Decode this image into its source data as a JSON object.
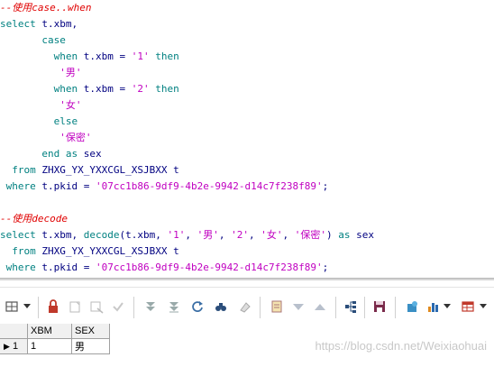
{
  "editor": {
    "line1": "--使用case..when",
    "line2_kw": "select",
    "line2_rest": "t.xbm,",
    "line3_kw": "case",
    "line4_kw1": "when",
    "line4_mid": "t.xbm =",
    "line4_str": "'1'",
    "line4_kw2": "then",
    "line5_str": "'男'",
    "line6_kw1": "when",
    "line6_mid": "t.xbm =",
    "line6_str": "'2'",
    "line6_kw2": "then",
    "line7_str": "'女'",
    "line8_kw": "else",
    "line9_str": "'保密'",
    "line10_kw1": "end",
    "line10_kw2": "as",
    "line10_id": "sex",
    "line11_kw": "from",
    "line11_id": "ZHXG_YX_YXXCGL_XSJBXX t",
    "line12_kw": "where",
    "line12_mid": "t.pkid =",
    "line12_str": "'07cc1b86-9df9-4b2e-9942-d14c7f238f89'",
    "line12_end": ";",
    "line14": "--使用decode",
    "line15_kw": "select",
    "line15_a": "t.xbm,",
    "line15_fn": "decode",
    "line15_b": "(t.xbm,",
    "line15_s1": "'1'",
    "line15_c1": ",",
    "line15_s2": "'男'",
    "line15_c2": ",",
    "line15_s3": "'2'",
    "line15_c3": ",",
    "line15_s4": "'女'",
    "line15_c4": ",",
    "line15_s5": "'保密'",
    "line15_c5": ")",
    "line15_kw2": "as",
    "line15_id": "sex",
    "line16_kw": "from",
    "line16_id": "ZHXG_YX_YXXCGL_XSJBXX t",
    "line17_kw": "where",
    "line17_mid": "t.pkid =",
    "line17_str": "'07cc1b86-9df9-4b2e-9942-d14c7f238f89'",
    "line17_end": ";"
  },
  "toolbar": {
    "icons": [
      "grid-options-icon",
      "dropdown-icon",
      "lock-icon",
      "new-record-icon",
      "delete-record-icon",
      "post-icon",
      "first-icon",
      "last-icon",
      "refresh-icon",
      "find-icon",
      "clear-icon",
      "query-icon",
      "filter-down-icon",
      "filter-up-icon",
      "tree-icon",
      "save-icon",
      "export-icon",
      "chart-icon",
      "table-icon"
    ]
  },
  "results": {
    "columns": [
      "XBM",
      "SEX"
    ],
    "rows": [
      {
        "num": "1",
        "xbm": "1",
        "sex": "男"
      }
    ]
  },
  "watermark": "https://blog.csdn.net/Weixiaohuai"
}
